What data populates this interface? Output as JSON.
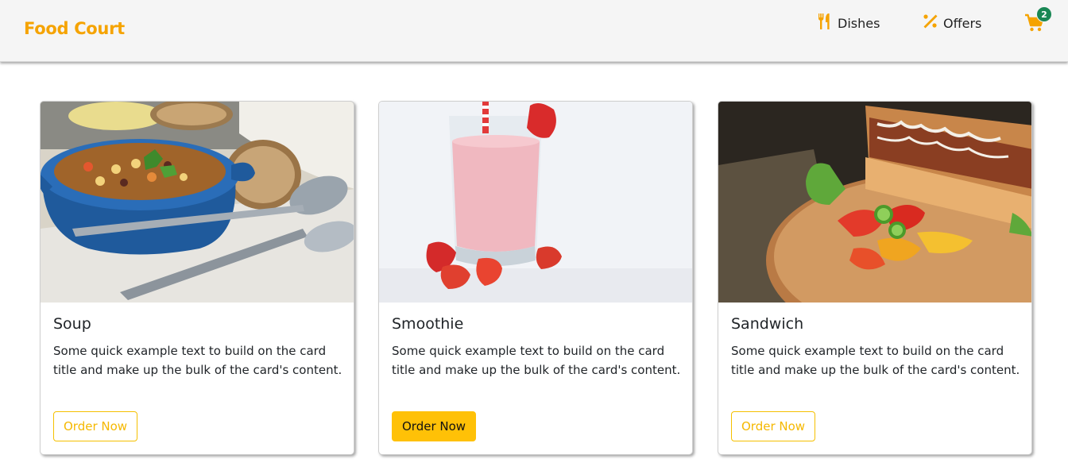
{
  "brand": "Food Court",
  "nav": {
    "dishes_label": "Dishes",
    "offers_label": "Offers",
    "cart_count": "2"
  },
  "colors": {
    "accent": "#f5a300",
    "badge": "#198754",
    "button": "#ffc107"
  },
  "cards": [
    {
      "title": "Soup",
      "text": "Some quick example text to build on the card title and make up the bulk of the card's content.",
      "button": "Order Now"
    },
    {
      "title": "Smoothie",
      "text": "Some quick example text to build on the card title and make up the bulk of the card's content.",
      "button": "Order Now"
    },
    {
      "title": "Sandwich",
      "text": "Some quick example text to build on the card title and make up the bulk of the card's content.",
      "button": "Order Now"
    }
  ]
}
